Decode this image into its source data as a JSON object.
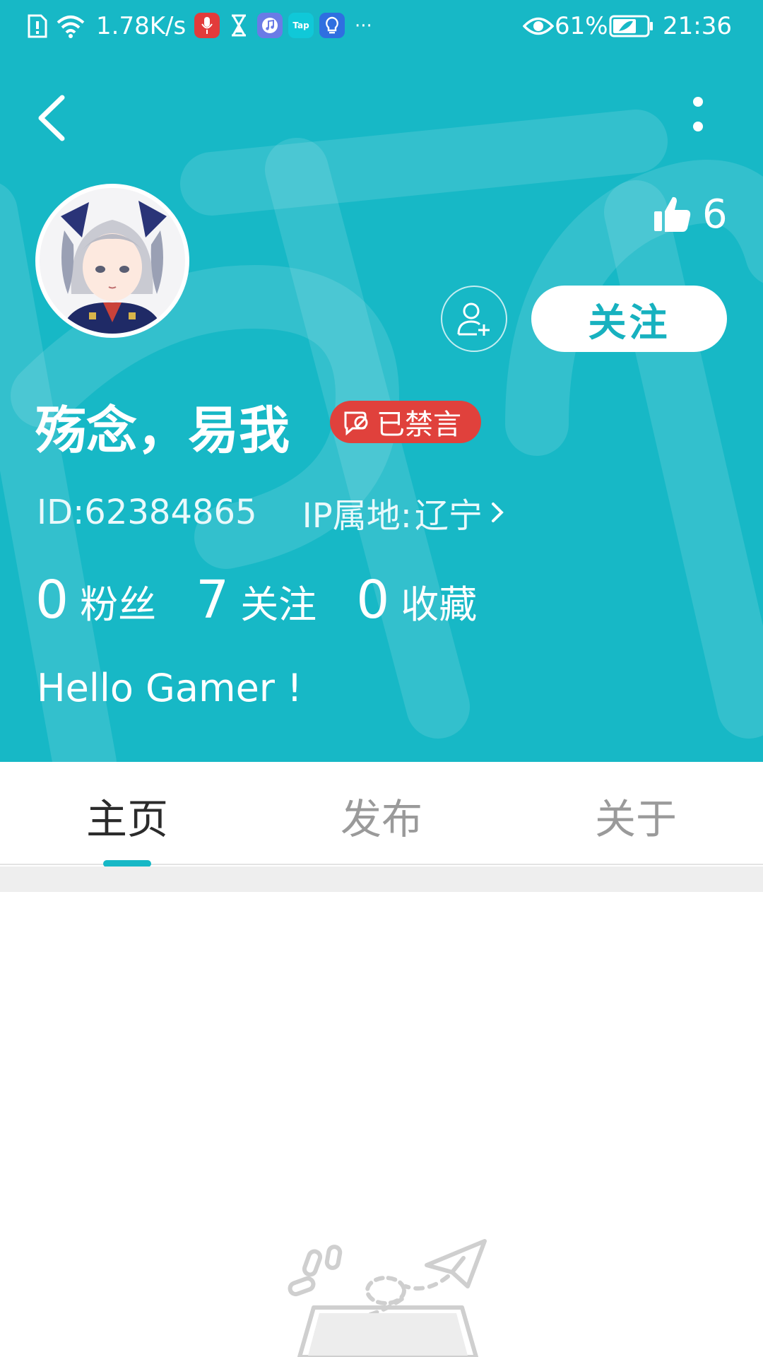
{
  "status_bar": {
    "net_speed": "1.78K/s",
    "overflow_dots": "···",
    "battery": "61%",
    "time": "21:36",
    "app_icons": [
      "microphone-app",
      "hourglass-app",
      "music-app",
      "taptap-app",
      "lightbulb-app"
    ],
    "taptap_label": "Tap"
  },
  "profile": {
    "likes": "6",
    "follow_label": "关注",
    "name": "殇念，易我",
    "badge": "已禁言",
    "id_text": "ID:62384865",
    "ip_label": "IP属地:",
    "ip_value": "辽宁",
    "stats": [
      {
        "num": "0",
        "label": "粉丝"
      },
      {
        "num": "7",
        "label": "关注"
      },
      {
        "num": "0",
        "label": "收藏"
      }
    ],
    "bio": "Hello Gamer !"
  },
  "tabs": [
    {
      "label": "主页",
      "active": true
    },
    {
      "label": "发布",
      "active": false
    },
    {
      "label": "关于",
      "active": false
    }
  ],
  "colors": {
    "header_bg": "#17b8c6",
    "accent": "#17b1bf",
    "muted_badge": "#e0413c"
  }
}
